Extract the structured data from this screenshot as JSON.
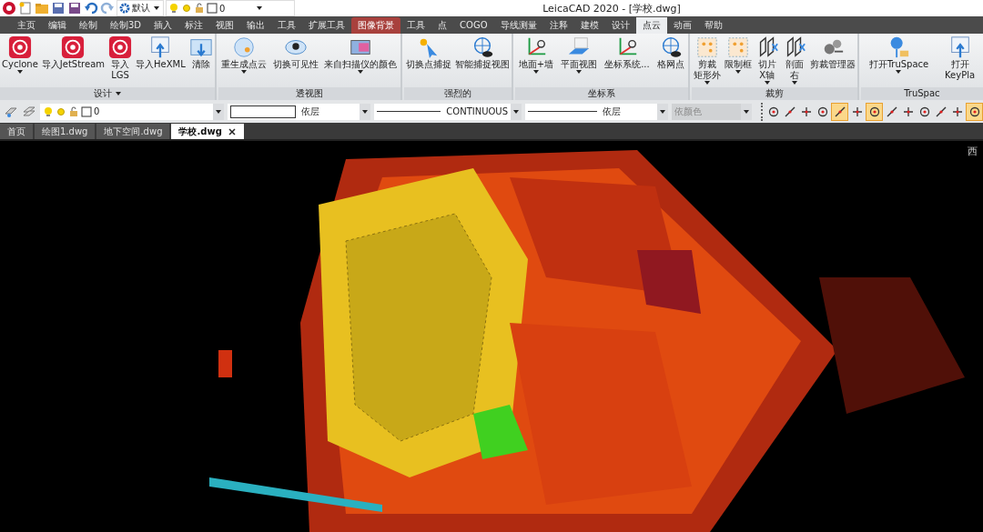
{
  "window": {
    "title": "LeicaCAD 2020 - [学校.dwg]"
  },
  "quick_access": {
    "workspace": "默认",
    "layer": "0"
  },
  "menu_tabs": [
    {
      "label": "主页",
      "selected": false,
      "kind": "normal"
    },
    {
      "label": "编辑",
      "selected": false,
      "kind": "normal"
    },
    {
      "label": "绘制",
      "selected": false,
      "kind": "normal"
    },
    {
      "label": "绘制3D",
      "selected": false,
      "kind": "normal"
    },
    {
      "label": "插入",
      "selected": false,
      "kind": "normal"
    },
    {
      "label": "标注",
      "selected": false,
      "kind": "normal"
    },
    {
      "label": "视图",
      "selected": false,
      "kind": "normal"
    },
    {
      "label": "输出",
      "selected": false,
      "kind": "normal"
    },
    {
      "label": "工具",
      "selected": false,
      "kind": "normal"
    },
    {
      "label": "扩展工具",
      "selected": false,
      "kind": "normal"
    },
    {
      "label": "图像背景",
      "selected": false,
      "kind": "contextual"
    },
    {
      "label": "工具",
      "selected": false,
      "kind": "normal"
    },
    {
      "label": "点",
      "selected": false,
      "kind": "normal"
    },
    {
      "label": "COGO",
      "selected": false,
      "kind": "normal"
    },
    {
      "label": "导线测量",
      "selected": false,
      "kind": "normal"
    },
    {
      "label": "注释",
      "selected": false,
      "kind": "normal"
    },
    {
      "label": "建模",
      "selected": false,
      "kind": "normal"
    },
    {
      "label": "设计",
      "selected": false,
      "kind": "normal"
    },
    {
      "label": "点云",
      "selected": true,
      "kind": "normal"
    },
    {
      "label": "动画",
      "selected": false,
      "kind": "normal"
    },
    {
      "label": "帮助",
      "selected": false,
      "kind": "normal"
    }
  ],
  "ribbon_panels": [
    {
      "title": "设计",
      "title_dropdown": true,
      "kind": "design",
      "buttons": [
        {
          "label": "Cyclone",
          "dropdown": true
        },
        {
          "label": "导入JetStream",
          "dropdown": false
        },
        {
          "label": "导入",
          "label_line2": "LGS",
          "dropdown": false
        },
        {
          "label": "导入HeXML",
          "dropdown": false
        },
        {
          "label": "清除",
          "dropdown": false
        }
      ]
    },
    {
      "title": "透视图",
      "title_dropdown": false,
      "kind": "view",
      "buttons": [
        {
          "label": "重生成点云",
          "dropdown": true
        },
        {
          "label": "切换可见性",
          "dropdown": false
        },
        {
          "label": "来自扫描仪的颜色",
          "dropdown": true
        }
      ]
    },
    {
      "title": "强烈的",
      "title_dropdown": false,
      "kind": "snap",
      "buttons": [
        {
          "label": "切换点捕捉",
          "dropdown": false
        },
        {
          "label": "智能捕捉视图",
          "dropdown": false
        }
      ]
    },
    {
      "title": "坐标系",
      "title_dropdown": false,
      "kind": "ucs",
      "buttons": [
        {
          "label": "地面+墙",
          "dropdown": true
        },
        {
          "label": "平面视图",
          "dropdown": true
        },
        {
          "label": "坐标系统...",
          "dropdown": false
        },
        {
          "label": "格网点",
          "dropdown": false
        }
      ]
    },
    {
      "title": "裁剪",
      "title_dropdown": false,
      "kind": "clip",
      "buttons": [
        {
          "label": "剪裁",
          "label_line2": "矩形外",
          "dropdown": true
        },
        {
          "label": "限制框",
          "dropdown": true
        },
        {
          "label": "切片",
          "label_line2": "X轴",
          "dropdown": true
        },
        {
          "label": "剖面",
          "label_line2": "右",
          "dropdown": true
        },
        {
          "label": "剪裁管理器",
          "dropdown": false
        }
      ]
    },
    {
      "title": "TruSpac",
      "title_dropdown": false,
      "kind": "truspace",
      "buttons": [
        {
          "label": "打开TruSpace",
          "dropdown": true
        },
        {
          "label": "打开",
          "label_line2": "KeyPla",
          "dropdown": false
        }
      ]
    }
  ],
  "properties_bar": {
    "layer": "0",
    "color_setting": "依层",
    "linetype": "CONTINUOUS",
    "lineweight": "依层",
    "plot_style": "依颜色",
    "plot_style_disabled": true
  },
  "snap_tools": [
    {
      "active": false
    },
    {
      "active": false
    },
    {
      "active": false
    },
    {
      "active": false
    },
    {
      "active": true
    },
    {
      "active": false
    },
    {
      "active": true
    },
    {
      "active": false
    },
    {
      "active": false
    },
    {
      "active": false
    },
    {
      "active": false
    },
    {
      "active": false
    },
    {
      "active": true
    }
  ],
  "file_tabs": [
    {
      "label": "首页",
      "selected": false
    },
    {
      "label": "绘图1.dwg",
      "selected": false
    },
    {
      "label": "地下空间.dwg",
      "selected": false
    },
    {
      "label": "学校.dwg",
      "selected": true
    }
  ],
  "viewcube": {
    "label": "西"
  }
}
